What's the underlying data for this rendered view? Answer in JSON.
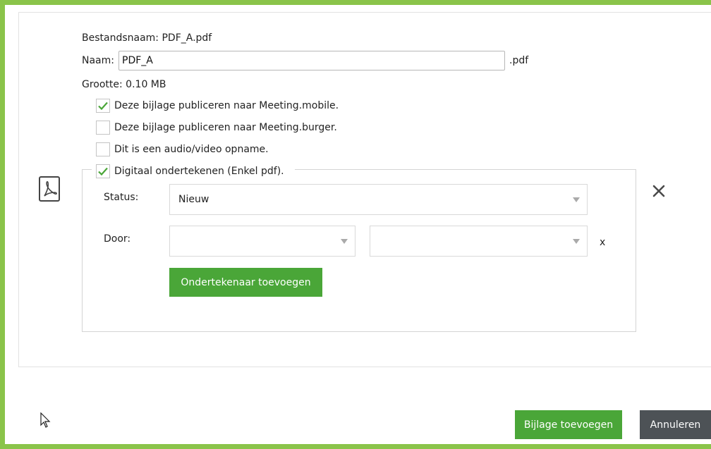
{
  "file": {
    "filename_label": "Bestandsnaam: PDF_A.pdf",
    "name_label": "Naam:",
    "name_value": "PDF_A",
    "extension": ".pdf",
    "size_label": "Grootte: 0.10 MB"
  },
  "options": [
    {
      "label": "Deze bijlage publiceren naar Meeting.mobile.",
      "checked": true
    },
    {
      "label": "Deze bijlage publiceren naar Meeting.burger.",
      "checked": false
    },
    {
      "label": "Dit is een audio/video opname.",
      "checked": false
    },
    {
      "label": "Digitaal ondertekenen (Enkel pdf).",
      "checked": true
    }
  ],
  "signing": {
    "status_label": "Status:",
    "status_value": "Nieuw",
    "by_label": "Door:",
    "by_first_value": "",
    "by_second_value": "",
    "remove_signer_label": "x",
    "add_signer_label": "Ondertekenaar toevoegen"
  },
  "footer": {
    "add_attachment_label": "Bijlage toevoegen",
    "cancel_label": "Annuleren"
  },
  "colors": {
    "accent_green": "#4aa638",
    "frame_green": "#8ac44a",
    "cancel_gray": "#4d5256",
    "check_green": "#4aa638"
  },
  "icons": {
    "file_type": "pdf-file-icon",
    "remove": "close-icon",
    "cursor": "mouse-pointer-icon"
  }
}
